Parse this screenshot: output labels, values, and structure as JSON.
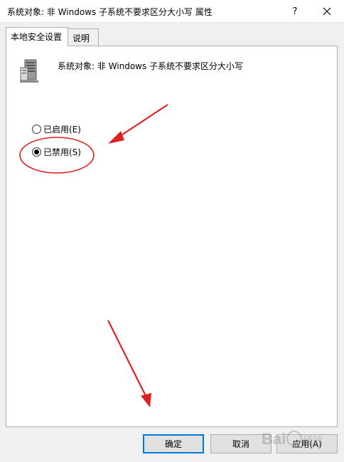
{
  "window": {
    "title": "系统对象: 非 Windows 子系统不要求区分大小写 属性",
    "help_label": "?",
    "close_icon": "close-icon"
  },
  "tabs": [
    {
      "label": "本地安全设置",
      "active": true
    },
    {
      "label": "说明",
      "active": false
    }
  ],
  "policy": {
    "icon": "server-computer-icon",
    "name": "系统对象: 非 Windows 子系统不要求区分大小写"
  },
  "options": [
    {
      "label": "已启用(E)",
      "selected": false
    },
    {
      "label": "已禁用(S)",
      "selected": true
    }
  ],
  "buttons": {
    "ok": "确定",
    "cancel": "取消",
    "apply": "应用(A)"
  },
  "watermark": "Baidu经验",
  "colors": {
    "annotation": "#e02020",
    "focus_border": "#0078d7"
  }
}
